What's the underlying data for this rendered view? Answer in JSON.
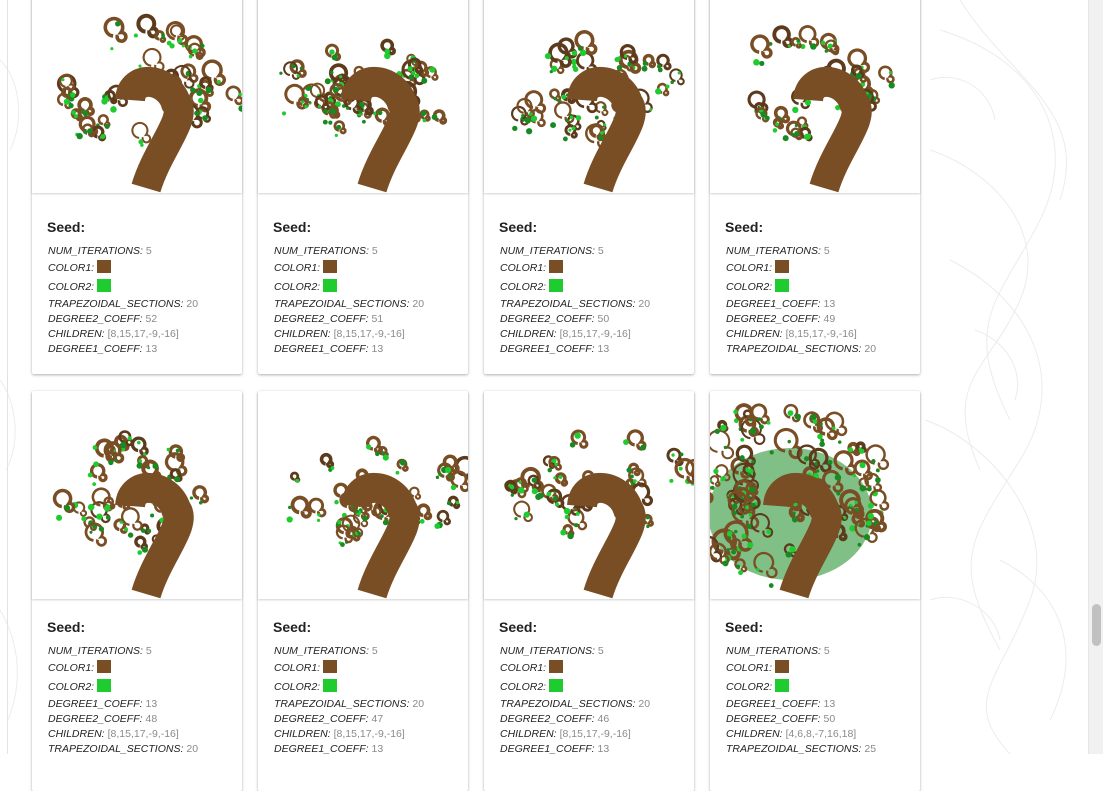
{
  "colors": {
    "trunk": "#7a4e25",
    "trunk_dark": "#5c3a1b",
    "leaf": "#1fcc30",
    "leaf_dark": "#178a22"
  },
  "cards": [
    {
      "seed_label": "Seed:",
      "tree": {
        "sway": -1.0,
        "bushiness": 0.35,
        "lean": 0.45
      },
      "params": [
        {
          "name": "NUM_ITERATIONS:",
          "value": "5"
        },
        {
          "name": "COLOR1:",
          "swatch": "#7a4e25"
        },
        {
          "name": "COLOR2:",
          "swatch": "#1fcc30"
        },
        {
          "name": "TRAPEZOIDAL_SECTIONS:",
          "value": "20"
        },
        {
          "name": "DEGREE2_COEFF:",
          "value": "52"
        },
        {
          "name": "CHILDREN:",
          "value": "[8,15,17,-9,-16]"
        },
        {
          "name": "DEGREE1_COEFF:",
          "value": "13"
        }
      ]
    },
    {
      "seed_label": "Seed:",
      "tree": {
        "sway": -1.0,
        "bushiness": 0.35,
        "lean": 0.5
      },
      "params": [
        {
          "name": "NUM_ITERATIONS:",
          "value": "5"
        },
        {
          "name": "COLOR1:",
          "swatch": "#7a4e25"
        },
        {
          "name": "COLOR2:",
          "swatch": "#1fcc30"
        },
        {
          "name": "TRAPEZOIDAL_SECTIONS:",
          "value": "20"
        },
        {
          "name": "DEGREE2_COEFF:",
          "value": "51"
        },
        {
          "name": "CHILDREN:",
          "value": "[8,15,17,-9,-16]"
        },
        {
          "name": "DEGREE1_COEFF:",
          "value": "13"
        }
      ]
    },
    {
      "seed_label": "Seed:",
      "tree": {
        "sway": -1.0,
        "bushiness": 0.3,
        "lean": 0.3
      },
      "params": [
        {
          "name": "NUM_ITERATIONS:",
          "value": "5"
        },
        {
          "name": "COLOR1:",
          "swatch": "#7a4e25"
        },
        {
          "name": "COLOR2:",
          "swatch": "#1fcc30"
        },
        {
          "name": "TRAPEZOIDAL_SECTIONS:",
          "value": "20"
        },
        {
          "name": "DEGREE2_COEFF:",
          "value": "50"
        },
        {
          "name": "CHILDREN:",
          "value": "[8,15,17,-9,-16]"
        },
        {
          "name": "DEGREE1_COEFF:",
          "value": "13"
        }
      ]
    },
    {
      "seed_label": "Seed:",
      "tree": {
        "sway": -1.0,
        "bushiness": 0.25,
        "lean": 0.2
      },
      "params": [
        {
          "name": "NUM_ITERATIONS:",
          "value": "5"
        },
        {
          "name": "COLOR1:",
          "swatch": "#7a4e25"
        },
        {
          "name": "COLOR2:",
          "swatch": "#1fcc30"
        },
        {
          "name": "DEGREE1_COEFF:",
          "value": "13"
        },
        {
          "name": "DEGREE2_COEFF:",
          "value": "49"
        },
        {
          "name": "CHILDREN:",
          "value": "[8,15,17,-9,-16]"
        },
        {
          "name": "TRAPEZOIDAL_SECTIONS:",
          "value": "20"
        }
      ]
    },
    {
      "seed_label": "Seed:",
      "tree": {
        "sway": -1.0,
        "bushiness": 0.25,
        "lean": 0.2
      },
      "params": [
        {
          "name": "NUM_ITERATIONS:",
          "value": "5"
        },
        {
          "name": "COLOR1:",
          "swatch": "#7a4e25"
        },
        {
          "name": "COLOR2:",
          "swatch": "#1fcc30"
        },
        {
          "name": "DEGREE1_COEFF:",
          "value": "13"
        },
        {
          "name": "DEGREE2_COEFF:",
          "value": "48"
        },
        {
          "name": "CHILDREN:",
          "value": "[8,15,17,-9,-16]"
        },
        {
          "name": "TRAPEZOIDAL_SECTIONS:",
          "value": "20"
        }
      ]
    },
    {
      "seed_label": "Seed:",
      "tree": {
        "sway": -1.0,
        "bushiness": 0.3,
        "lean": 0.8
      },
      "params": [
        {
          "name": "NUM_ITERATIONS:",
          "value": "5"
        },
        {
          "name": "COLOR1:",
          "swatch": "#7a4e25"
        },
        {
          "name": "COLOR2:",
          "swatch": "#1fcc30"
        },
        {
          "name": "TRAPEZOIDAL_SECTIONS:",
          "value": "20"
        },
        {
          "name": "DEGREE2_COEFF:",
          "value": "47"
        },
        {
          "name": "CHILDREN:",
          "value": "[8,15,17,-9,-16]"
        },
        {
          "name": "DEGREE1_COEFF:",
          "value": "13"
        }
      ]
    },
    {
      "seed_label": "Seed:",
      "tree": {
        "sway": -1.0,
        "bushiness": 0.3,
        "lean": 0.8
      },
      "params": [
        {
          "name": "NUM_ITERATIONS:",
          "value": "5"
        },
        {
          "name": "COLOR1:",
          "swatch": "#7a4e25"
        },
        {
          "name": "COLOR2:",
          "swatch": "#1fcc30"
        },
        {
          "name": "TRAPEZOIDAL_SECTIONS:",
          "value": "20"
        },
        {
          "name": "DEGREE2_COEFF:",
          "value": "46"
        },
        {
          "name": "CHILDREN:",
          "value": "[8,15,17,-9,-16]"
        },
        {
          "name": "DEGREE1_COEFF:",
          "value": "13"
        }
      ]
    },
    {
      "seed_label": "Seed:",
      "tree": {
        "sway": -0.6,
        "bushiness": 1.0,
        "lean": 0.0
      },
      "params": [
        {
          "name": "NUM_ITERATIONS:",
          "value": "5"
        },
        {
          "name": "COLOR1:",
          "swatch": "#7a4e25"
        },
        {
          "name": "COLOR2:",
          "swatch": "#1fcc30"
        },
        {
          "name": "DEGREE1_COEFF:",
          "value": "13"
        },
        {
          "name": "DEGREE2_COEFF:",
          "value": "50"
        },
        {
          "name": "CHILDREN:",
          "value": "[4,6,8,-7,16,18]"
        },
        {
          "name": "TRAPEZOIDAL_SECTIONS:",
          "value": "25"
        }
      ]
    }
  ]
}
